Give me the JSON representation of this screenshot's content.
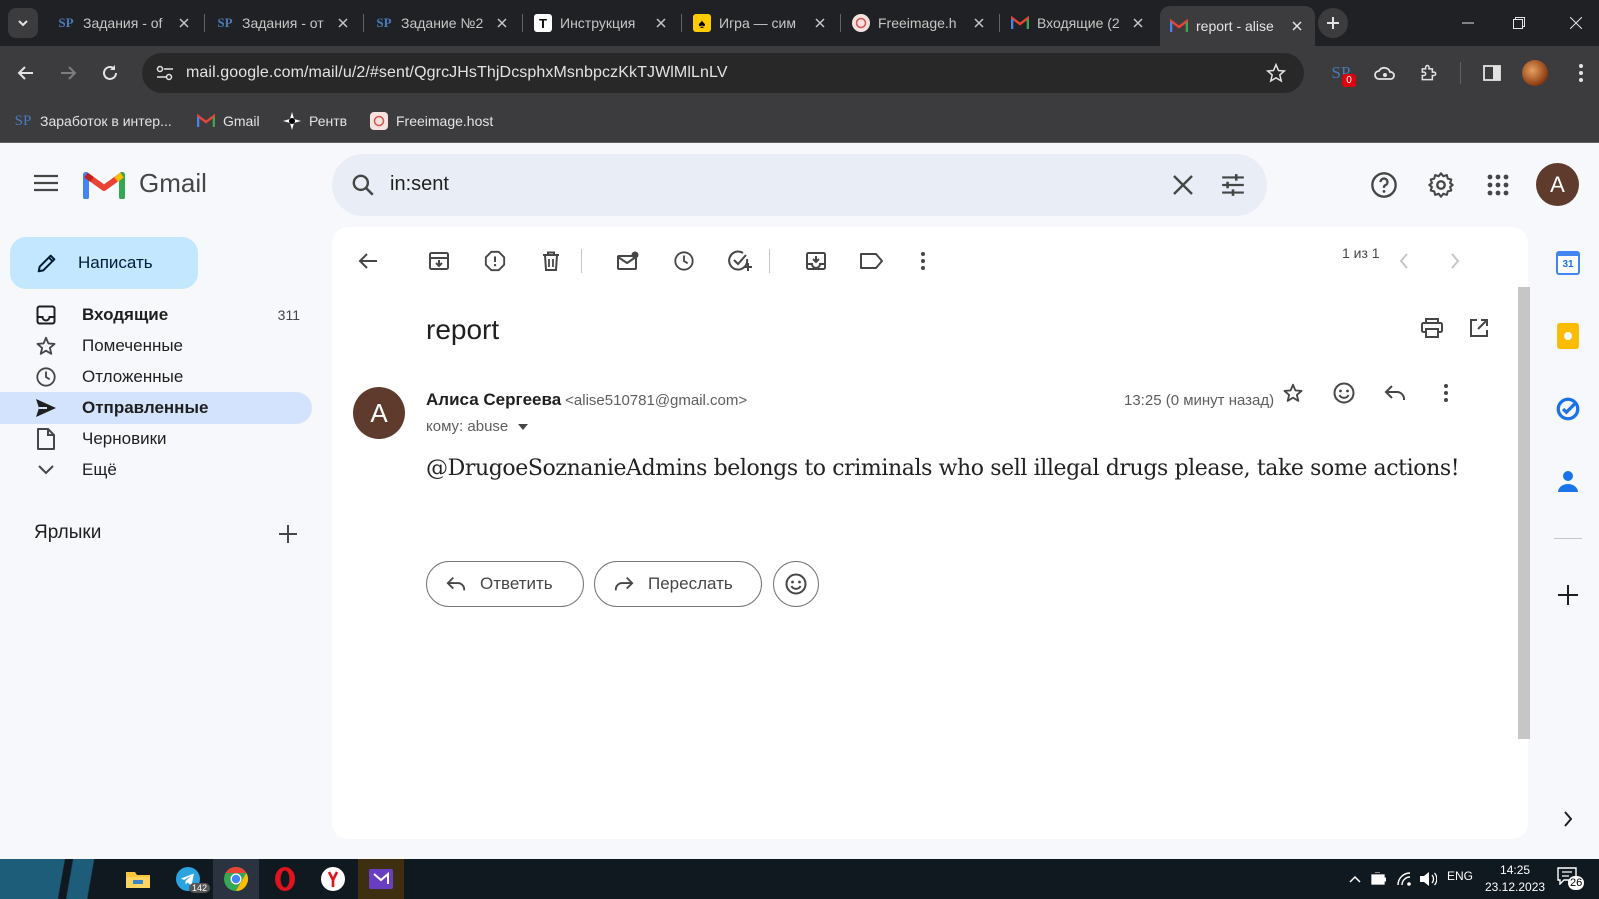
{
  "browser": {
    "tabs": [
      {
        "title": "Задания - of",
        "favicon": "sp-icon"
      },
      {
        "title": "Задания - от",
        "favicon": "sp-icon"
      },
      {
        "title": "Задание №2",
        "favicon": "sp-icon"
      },
      {
        "title": "Инструкция",
        "favicon": "t-icon"
      },
      {
        "title": "Игра — сим",
        "favicon": "yellow-icon"
      },
      {
        "title": "Freeimage.h",
        "favicon": "freeimage-icon"
      },
      {
        "title": "Входящие (2",
        "favicon": "gmail-icon"
      },
      {
        "title": "report - alise",
        "favicon": "gmail-icon",
        "active": true
      }
    ],
    "url": "mail.google.com/mail/u/2/#sent/QgrcJHsThjDcsphxMsnbpczKkTJWlMlLnLV",
    "ext_badge": "0",
    "bookmarks": [
      {
        "label": "Заработок в интер...",
        "icon": "sp-icon"
      },
      {
        "label": "Gmail",
        "icon": "gmail-icon"
      },
      {
        "label": "Рентв",
        "icon": "star-icon"
      },
      {
        "label": "Freeimage.host",
        "icon": "freeimage-icon"
      }
    ]
  },
  "gmail": {
    "logo_text": "Gmail",
    "search_query": "in:sent",
    "avatar_letter": "A",
    "compose_label": "Написать",
    "nav": [
      {
        "label": "Входящие",
        "count": "311",
        "icon": "inbox-icon"
      },
      {
        "label": "Помеченные",
        "count": "",
        "icon": "star-icon"
      },
      {
        "label": "Отложенные",
        "count": "",
        "icon": "clock-icon"
      },
      {
        "label": "Отправленные",
        "count": "",
        "icon": "send-icon"
      },
      {
        "label": "Черновики",
        "count": "",
        "icon": "draft-icon"
      },
      {
        "label": "Ещё",
        "count": "",
        "icon": "chevron-down-icon"
      }
    ],
    "labels_title": "Ярлыки",
    "pager": "1 из 1",
    "message": {
      "subject": "report",
      "sender_name": "Алиса Сергеева",
      "sender_email": "<alise510781@gmail.com>",
      "to": "кому: abuse",
      "time": "13:25 (0 минут назад)",
      "body": "@DrugoeSoznanieAdmins belongs to criminals who sell illegal drugs please, take some actions!",
      "avatar_letter": "A"
    },
    "reply_label": "Ответить",
    "forward_label": "Переслать",
    "calendar_day": "31"
  },
  "taskbar": {
    "telegram_badge": "142",
    "lang": "ENG",
    "time": "14:25",
    "date": "23.12.2023",
    "notifications": "26"
  },
  "colors": {
    "active_nav": "#d3e3fd",
    "compose": "#c2e7ff",
    "search_bg": "#e9eef6",
    "page_bg": "#f6f8fc"
  }
}
